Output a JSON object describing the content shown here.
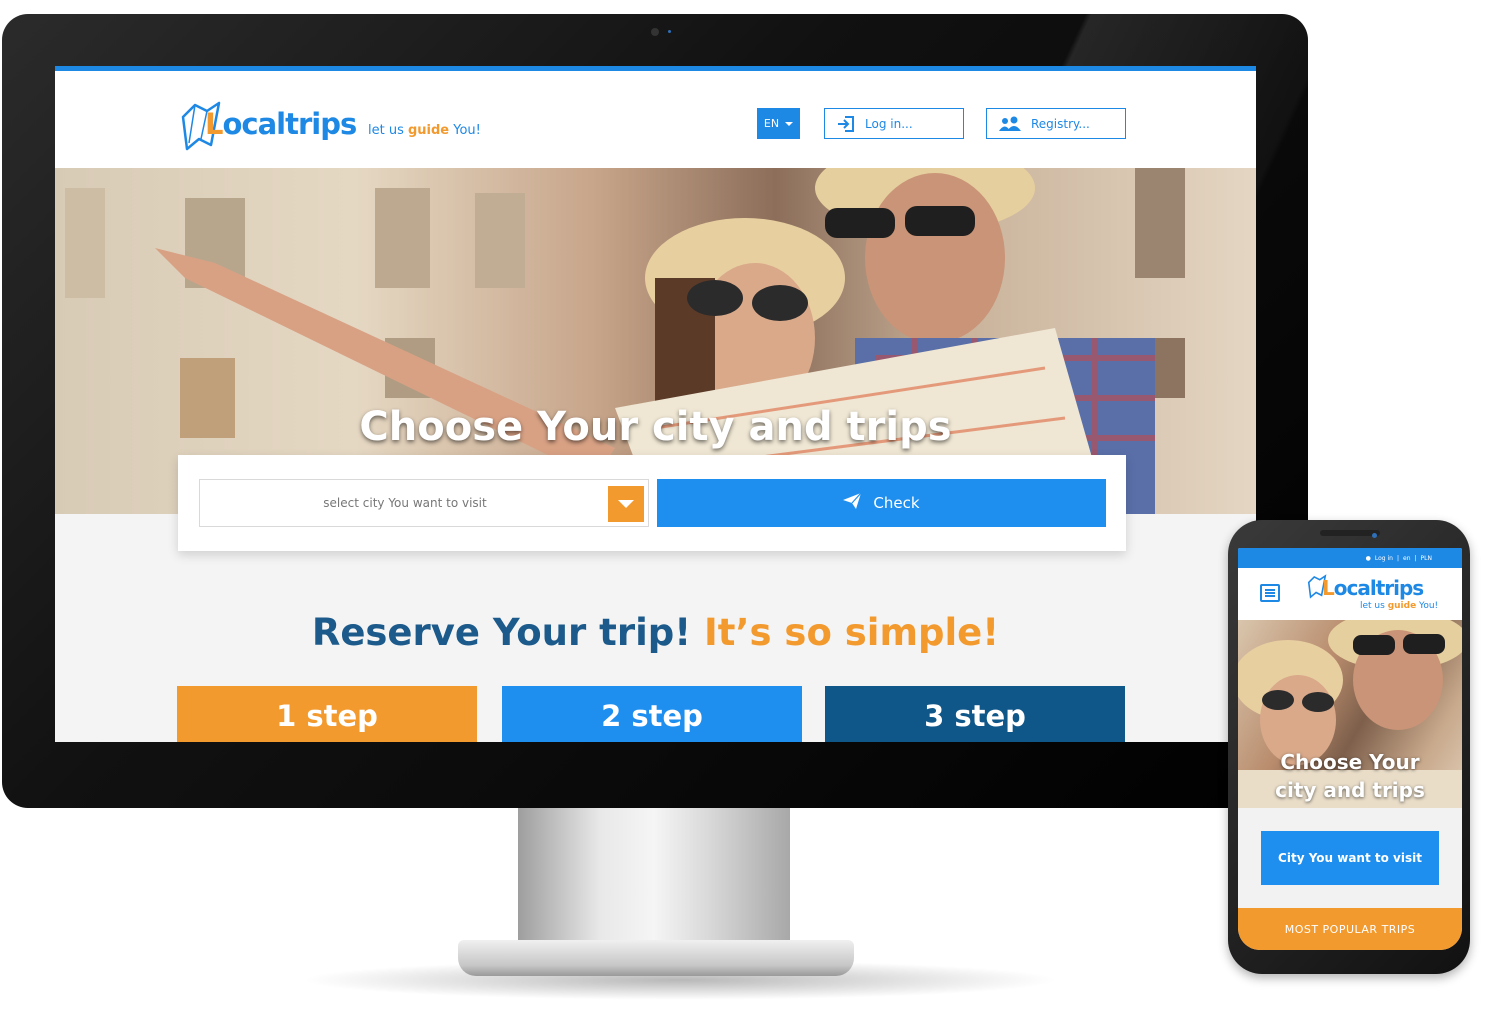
{
  "desktop": {
    "header": {
      "logo_text": "ocaltrips",
      "logo_initial": "L",
      "tagline_pre": "let us ",
      "tagline_highlight": "guide",
      "tagline_post": " You!",
      "language": "EN",
      "login_label": "Log in...",
      "registry_label": "Registry..."
    },
    "hero": {
      "title": "Choose Your city and trips"
    },
    "search": {
      "city_placeholder": "select city You want to visit",
      "check_label": "Check"
    },
    "reserve": {
      "title_part1": "Reserve Your trip! ",
      "title_part2": "It’s so simple!"
    },
    "steps": [
      {
        "label": "1 step"
      },
      {
        "label": "2 step"
      },
      {
        "label": "3 step"
      }
    ]
  },
  "mobile": {
    "topbar": {
      "login": "Log in",
      "language": "en",
      "currency": "PLN"
    },
    "logo_text": "ocaltrips",
    "logo_initial": "L",
    "tagline_pre": "let us ",
    "tagline_highlight": "guide",
    "tagline_post": " You!",
    "hero_title_line1": "Choose Your",
    "hero_title_line2": "city and trips",
    "city_button": "City You want to visit",
    "popular_button": "MOST POPULAR TRIPS"
  },
  "colors": {
    "primary_blue": "#1e88e5",
    "accent_orange": "#f39a2e",
    "dark_blue": "#0f5689"
  }
}
